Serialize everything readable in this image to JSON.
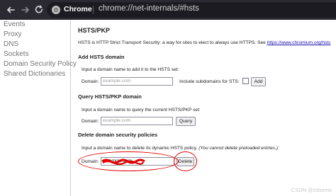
{
  "browser": {
    "tab_label": "Chrome",
    "url": "chrome://net-internals/#hsts"
  },
  "sidebar": {
    "items": [
      {
        "label": "Events"
      },
      {
        "label": "Proxy"
      },
      {
        "label": "DNS"
      },
      {
        "label": "Sockets"
      },
      {
        "label": "Domain Security Policy"
      },
      {
        "label": "Shared Dictionaries"
      }
    ]
  },
  "main": {
    "title": "HSTS/PKP",
    "intro_text": "HSTS is HTTP Strict Transport Security: a way for sites to elect to always use HTTPS. See",
    "intro_link": "https://www.chromium.org/hsts",
    "add": {
      "heading": "Add HSTS domain",
      "instruction": "Input a domain name to add it to the HSTS set:",
      "domain_label": "Domain:",
      "placeholder": "example.com",
      "subdomains_label": "Include subdomains for STS:",
      "button": "Add"
    },
    "query": {
      "heading": "Query HSTS/PKP domain",
      "instruction": "Input a domain name to query the current HSTS/PKP set:",
      "domain_label": "Domain:",
      "placeholder": "example.com",
      "button": "Query"
    },
    "delete": {
      "heading": "Delete domain security policies",
      "instruction_start": "Input a domain name to delete its dynamic HSTS policy.",
      "instruction_note": "(You cannot delete preloaded entries.):",
      "domain_label": "Domain:",
      "value": "          .example.com",
      "button": "Delete"
    }
  },
  "watermark": "CSDN @zdsemo",
  "colors": {
    "topbar": "#2b2a33",
    "annotation": "#e10000",
    "link": "#1a0dab"
  }
}
